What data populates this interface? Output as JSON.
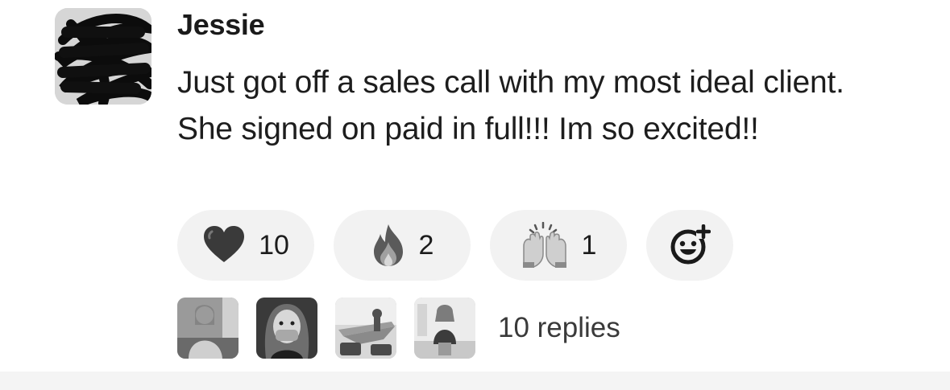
{
  "message": {
    "author": "Jessie",
    "text": "Just got off a sales call with my most ideal client. She signed on paid in full!!! Im so excited!!",
    "reactions": [
      {
        "emoji": "heart-icon",
        "count": "10"
      },
      {
        "emoji": "fire-icon",
        "count": "2"
      },
      {
        "emoji": "raised-hands-icon",
        "count": "1"
      }
    ],
    "add_reaction_icon": "add-reaction-icon",
    "thread": {
      "replies_label": "10 replies",
      "participant_count": 4
    }
  }
}
